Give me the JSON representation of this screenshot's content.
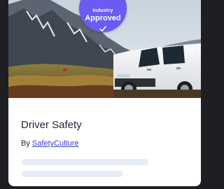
{
  "course": {
    "title": "Driver Safety",
    "by_prefix": "By",
    "author": "SafetyCulture"
  },
  "badge": {
    "top_text": "Industry",
    "main_text": "Approved",
    "icon": "check-icon",
    "color": "#6a5cf0"
  },
  "colors": {
    "link": "#3d3dc8",
    "placeholder_bar": "#e8edf5"
  }
}
